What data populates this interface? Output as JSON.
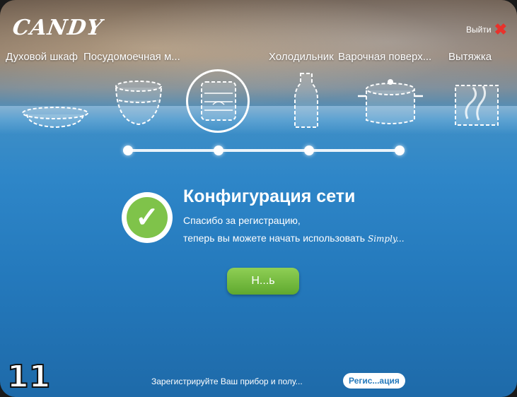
{
  "app": {
    "logo": "CANDY",
    "exit_label": "Выйти"
  },
  "categories": [
    {
      "label": "Духовой шкаф"
    },
    {
      "label": "Посудомоечная м..."
    },
    {
      "label": "Холодильник"
    },
    {
      "label": "Варочная поверх..."
    },
    {
      "label": "Вытяжка"
    }
  ],
  "wizard": {
    "title": "Конфигурация сети",
    "line1": "Спасибо за регистрацию,",
    "line2": "теперь вы можете начать использовать ",
    "brand_word": "Simply...",
    "next_label": "Н...ь"
  },
  "step_number": "11",
  "footer": {
    "text": "Зарегистрируйте Ваш прибор и полу...",
    "register_label": "Регис...ация"
  },
  "colors": {
    "accent_green": "#7fc34a",
    "exit_red": "#e8322c",
    "background_blue": "#2e86c8"
  },
  "icons": [
    "exit-x-icon",
    "checkmark-icon",
    "oven-dish-icon",
    "dishwasher-bowls-icon",
    "plates-icon",
    "bottle-icon",
    "pot-icon",
    "steam-icon"
  ]
}
